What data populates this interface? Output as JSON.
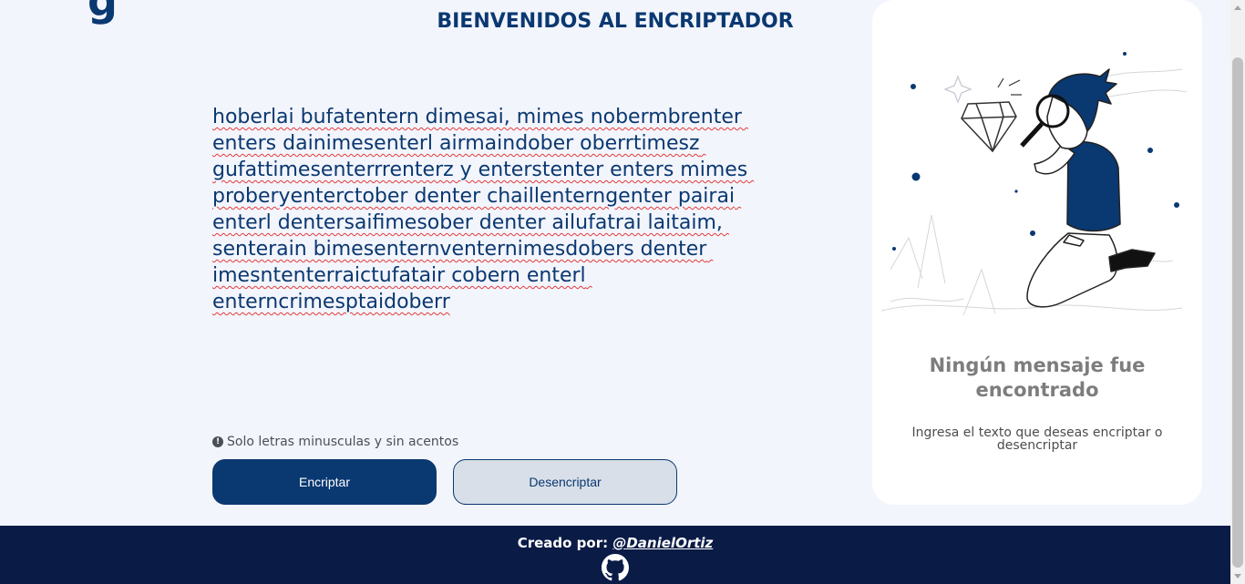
{
  "header": {
    "logo_fragment": "g",
    "title": "BIENVENIDOS AL ENCRIPTADOR"
  },
  "editor": {
    "value": "hoberlai bufatentern dimesai, mimes nobermbrenter enters dainimesenterl airmaindober oberrtimesz gufattimesenterrrenterz y enterstenter enters mimes proberyenterctober denter chaillenterngenter pairai enterl dentersaifimesober denter ailufatrai laitaim, senterain bimesenternventernimesdobers denter imesntenterraictufatair cobern enterl enterncrimesptaidoberr",
    "hint": "Solo letras minusculas y sin acentos",
    "hint_icon": "exclamation-circle-icon"
  },
  "actions": {
    "encrypt_label": "Encriptar",
    "decrypt_label": "Desencriptar"
  },
  "output_panel": {
    "empty_title": "Ningún mensaje fue encontrado",
    "empty_description": "Ingresa el texto que deseas encriptar o desencriptar",
    "illustration": "boy-with-magnifying-glass-illustration"
  },
  "footer": {
    "credit_prefix": "Creado por:",
    "credit_link": "@DanielOrtiz",
    "icon": "github-icon"
  },
  "colors": {
    "primary": "#0a3871",
    "background": "#f3f5fc",
    "footer": "#0a1b46",
    "card": "#ffffff",
    "muted_text": "#7d7d7d"
  }
}
